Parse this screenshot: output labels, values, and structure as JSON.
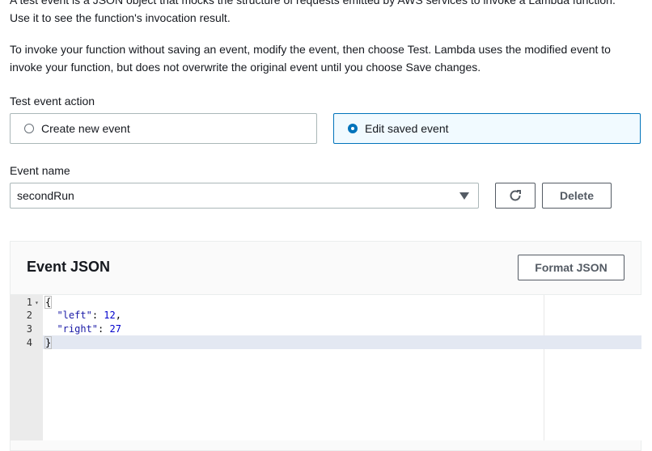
{
  "intro": {
    "line1": "A test event is a JSON object that mocks the structure of requests emitted by AWS services to invoke a Lambda function.",
    "line2": "Use it to see the function's invocation result.",
    "paragraph2": "To invoke your function without saving an event, modify the event, then choose Test. Lambda uses the modified event to invoke your function, but does not overwrite the original event until you choose Save changes."
  },
  "test_event_action": {
    "label": "Test event action",
    "options": [
      {
        "label": "Create new event",
        "selected": false
      },
      {
        "label": "Edit saved event",
        "selected": true
      }
    ]
  },
  "event_name": {
    "label": "Event name",
    "value": "secondRun"
  },
  "buttons": {
    "delete": "Delete",
    "format_json": "Format JSON",
    "refresh_icon": "refresh-icon"
  },
  "editor": {
    "title": "Event JSON",
    "lines": [
      {
        "number": "1",
        "text": "{"
      },
      {
        "number": "2",
        "key": "\"left\"",
        "value": "12",
        "trail": ","
      },
      {
        "number": "3",
        "key": "\"right\"",
        "value": "27",
        "trail": ""
      },
      {
        "number": "4",
        "text": "}"
      }
    ]
  },
  "colors": {
    "accent": "#0073bb",
    "selected_bg": "#f1faff",
    "border": "#aab7b8"
  }
}
